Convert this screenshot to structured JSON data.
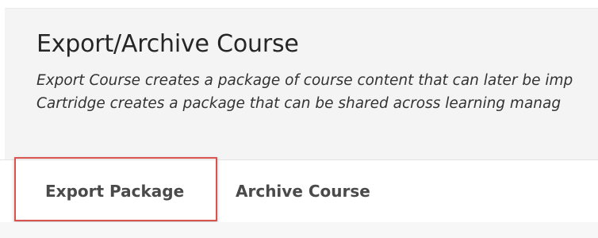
{
  "header": {
    "title": "Export/Archive Course",
    "description_line1": "Export Course creates a package of course content that can later be imp",
    "description_line2": "Cartridge creates a package that can be shared across learning manag"
  },
  "tabs": [
    {
      "label": "Export Package",
      "active": true
    },
    {
      "label": "Archive Course",
      "active": false
    }
  ],
  "colors": {
    "highlight_border": "#d9534f",
    "header_background": "#f4f4f4"
  }
}
